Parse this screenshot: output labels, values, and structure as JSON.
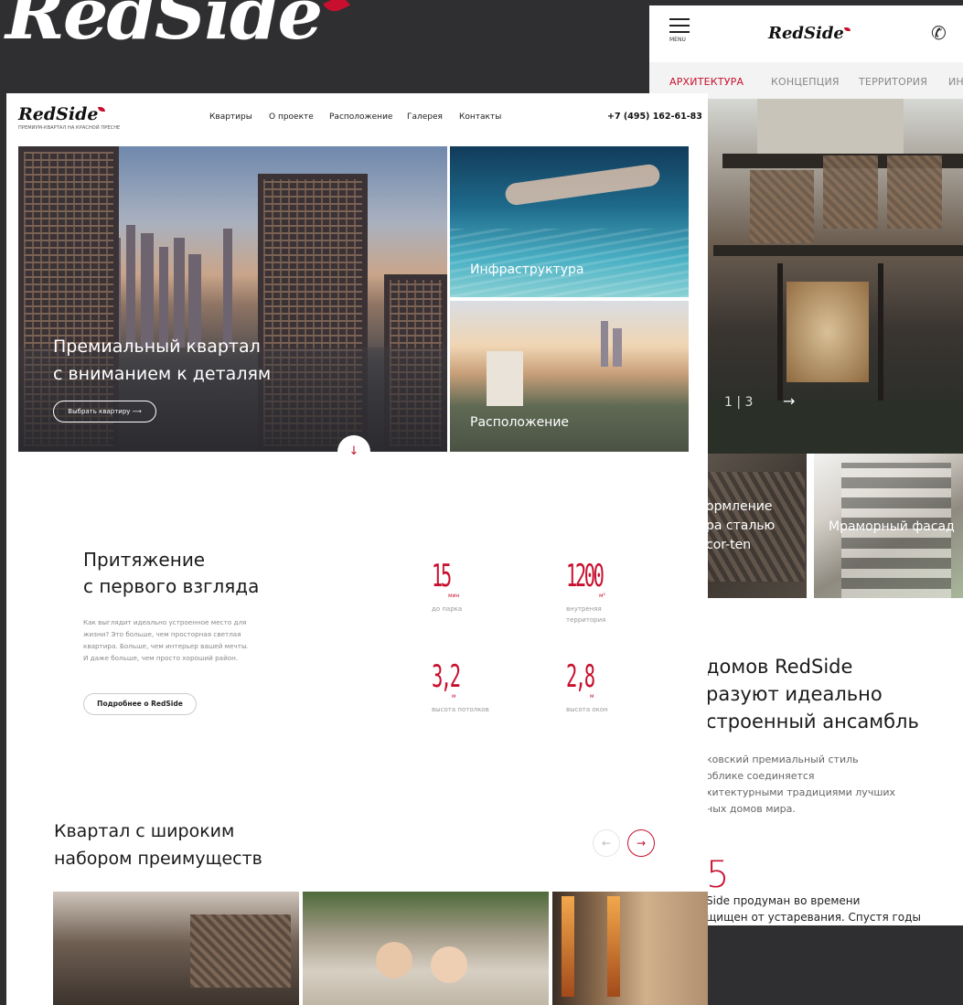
{
  "brand": {
    "big_logo": "RedSide"
  },
  "mobile": {
    "menu_label": "MENU",
    "logo": "RedSide",
    "tabs": [
      {
        "label": "АРХИТЕКТУРА",
        "active": true
      },
      {
        "label": "КОНЦЕПЦИЯ",
        "active": false
      },
      {
        "label": "ТЕРРИТОРИЯ",
        "active": false
      },
      {
        "label": "ИН",
        "active": false
      }
    ],
    "counter": "1 | 3",
    "card1_label": [
      "ормление",
      "ра сталью",
      "cor-ten"
    ],
    "card2_label": "Мраморный фасад",
    "heading": [
      "домов RedSide",
      "разуют идеально",
      "строенный ансамбль"
    ],
    "paragraph": [
      "ковский премиальный стиль",
      "облике соединяется",
      "хитектурными традициями лучших",
      "ных домов мира."
    ],
    "number": "5",
    "paragraph2": [
      "Side продуман во времени",
      "щищен от устаревания. Спустя годы"
    ]
  },
  "desktop": {
    "logo": "RedSide",
    "logo_sub": "ПРЕМИУМ-КВАРТАЛ НА КРАСНОЙ ПРЕСНЕ",
    "nav": [
      "Квартиры",
      "О проекте",
      "Расположение",
      "Галерея",
      "Контакты"
    ],
    "phone": "+7 (495) 162-61-83",
    "hero_title": [
      "Премиальный квартал",
      "с вниманием к деталям"
    ],
    "hero_button": "Выбрать квартиру",
    "tile_infra": "Инфраструктура",
    "tile_location": "Расположение",
    "section_heading": [
      "Притяжение",
      "с первого взгляда"
    ],
    "section_text": [
      "Как выглядит идеально устроенное место для",
      "жизни? Это больше, чем просторная светлая",
      "квартира. Больше, чем интерьер вашей мечты.",
      "И даже больше, чем просто хороший район."
    ],
    "section_button": "Подробнее о RedSide",
    "stats": [
      {
        "value": "15",
        "unit": "мин",
        "label": [
          "до парка"
        ]
      },
      {
        "value": "1200",
        "unit": "м²",
        "label": [
          "внутреняя",
          "территория"
        ]
      },
      {
        "value": "3,2",
        "unit": "м",
        "label": [
          "высота потолков"
        ]
      },
      {
        "value": "2,8",
        "unit": "м",
        "label": [
          "высота окон"
        ]
      }
    ],
    "section2_heading": [
      "Квартал с широким",
      "набором преимуществ"
    ]
  },
  "colors": {
    "accent": "#c8102e",
    "background": "#2f2f31"
  }
}
